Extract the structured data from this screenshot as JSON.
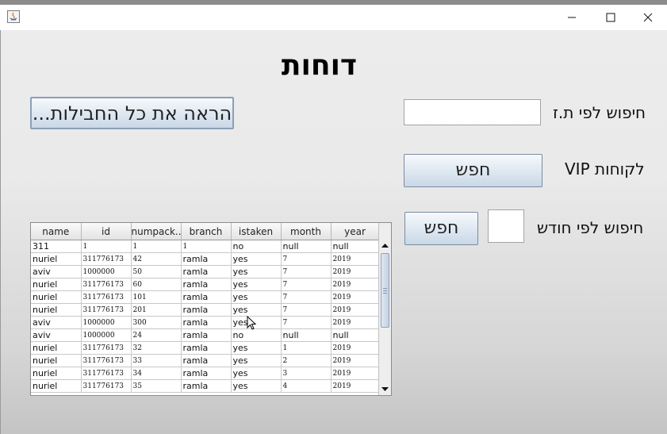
{
  "window": {
    "controls": [
      "minimize-icon",
      "maximize-icon",
      "close-icon"
    ]
  },
  "heading": "דוחות",
  "buttons": {
    "show_all": "הראה את כל החבילות...",
    "vip_search": "חפש",
    "month_search": "חפש"
  },
  "labels": {
    "search_by_id": "חיפוש לפי ת.ז",
    "vip_customers": "לקוחות VIP",
    "search_by_month": "חיפוש לפי חודש"
  },
  "inputs": {
    "id_value": "",
    "month_value": ""
  },
  "table": {
    "columns": [
      "name",
      "id",
      "numpack...",
      "branch",
      "istaken",
      "month",
      "year"
    ],
    "rows": [
      [
        "311",
        "1",
        "1",
        "1",
        "no",
        "null",
        "null"
      ],
      [
        "nuriel",
        "311776173",
        "42",
        "ramla",
        "yes",
        "7",
        "2019"
      ],
      [
        "aviv",
        "1000000",
        "50",
        "ramla",
        "yes",
        "7",
        "2019"
      ],
      [
        "nuriel",
        "311776173",
        "60",
        "ramla",
        "yes",
        "7",
        "2019"
      ],
      [
        "nuriel",
        "311776173",
        "101",
        "ramla",
        "yes",
        "7",
        "2019"
      ],
      [
        "nuriel",
        "311776173",
        "201",
        "ramla",
        "yes",
        "7",
        "2019"
      ],
      [
        "aviv",
        "1000000",
        "300",
        "ramla",
        "yes",
        "7",
        "2019"
      ],
      [
        "aviv",
        "1000000",
        "24",
        "ramla",
        "no",
        "null",
        "null"
      ],
      [
        "nuriel",
        "311776173",
        "32",
        "ramla",
        "yes",
        "1",
        "2019"
      ],
      [
        "nuriel",
        "311776173",
        "33",
        "ramla",
        "yes",
        "2",
        "2019"
      ],
      [
        "nuriel",
        "311776173",
        "34",
        "ramla",
        "yes",
        "3",
        "2019"
      ],
      [
        "nuriel",
        "311776173",
        "35",
        "ramla",
        "yes",
        "4",
        "2019"
      ]
    ]
  }
}
